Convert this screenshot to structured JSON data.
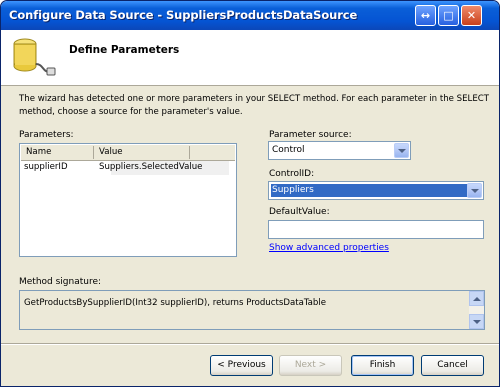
{
  "window": {
    "title": "Configure Data Source - SuppliersProductsDataSource"
  },
  "header": {
    "title": "Define Parameters",
    "icon": "database-connector-icon"
  },
  "description": "The wizard has detected one or more parameters in your SELECT method. For each parameter in the SELECT method, choose a source for the parameter's value.",
  "parameters": {
    "label": "Parameters:",
    "columns": [
      "Name",
      "Value"
    ],
    "rows": [
      {
        "name": "supplierID",
        "value": "Suppliers.SelectedValue"
      }
    ]
  },
  "parameter_source": {
    "label": "Parameter source:",
    "value": "Control"
  },
  "control_id": {
    "label": "ControlID:",
    "value": "Suppliers"
  },
  "default_value": {
    "label": "DefaultValue:",
    "value": ""
  },
  "advanced_link": "Show advanced properties",
  "method_signature": {
    "label": "Method signature:",
    "value": "GetProductsBySupplierID(Int32 supplierID), returns ProductsDataTable"
  },
  "buttons": {
    "previous": "< Previous",
    "next": "Next >",
    "finish": "Finish",
    "cancel": "Cancel"
  }
}
